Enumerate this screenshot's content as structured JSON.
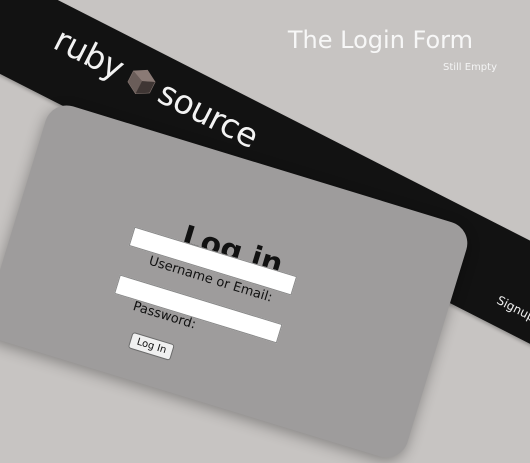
{
  "header": {
    "logo_left": "ruby",
    "logo_right": "source",
    "logo_icon": "ruby-gem-icon",
    "signup_label": "Signup"
  },
  "page": {
    "title": "The Login Form",
    "subtitle": "Still Empty"
  },
  "login_form": {
    "heading": "Log in",
    "username_label": "Username or Email:",
    "username_value": "",
    "password_label": "Password:",
    "password_value": "",
    "submit_label": "Log In"
  },
  "colors": {
    "background": "#c7c4c2",
    "banner": "#121212",
    "card": "#9e9c9c",
    "title_text": "#f7f7f7"
  }
}
